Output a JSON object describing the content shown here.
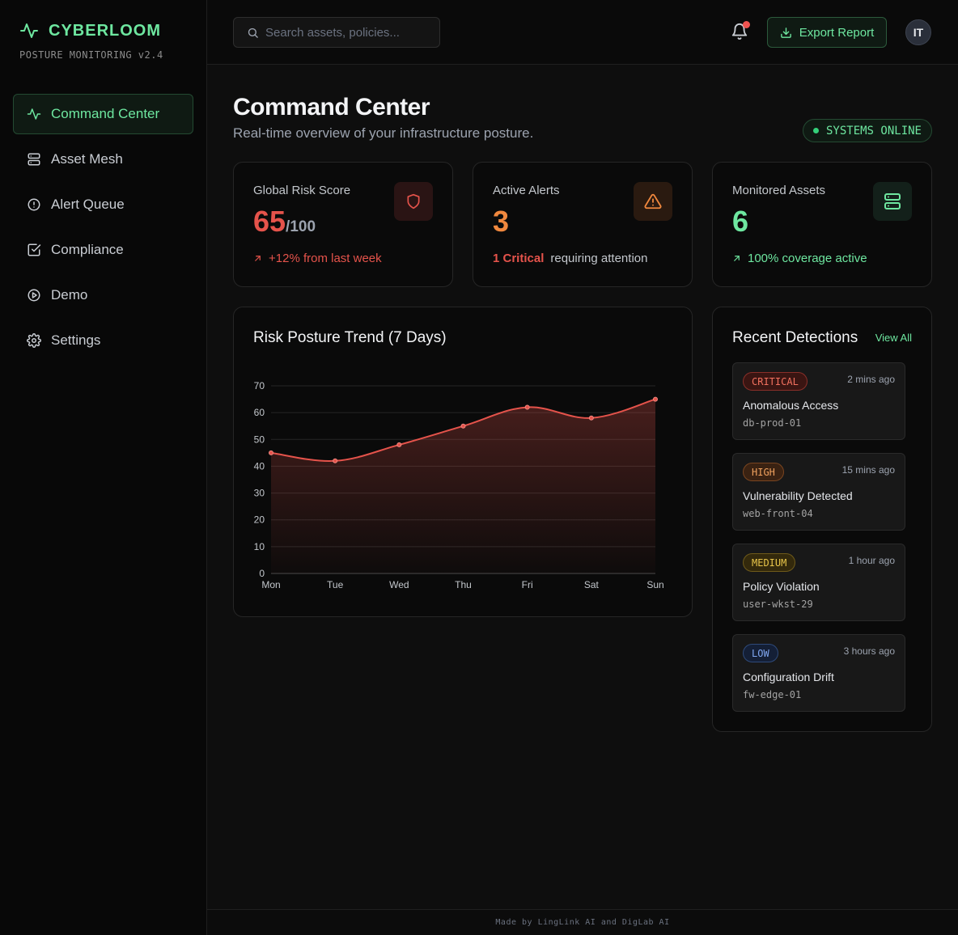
{
  "brand": {
    "name": "CYBERLOOM",
    "subtitle": "POSTURE MONITORING v2.4",
    "accent": "#6ee7a0"
  },
  "sidebar": {
    "items": [
      {
        "label": "Command Center",
        "icon": "activity-icon",
        "active": true
      },
      {
        "label": "Asset Mesh",
        "icon": "server-icon"
      },
      {
        "label": "Alert Queue",
        "icon": "alert-circle-icon"
      },
      {
        "label": "Compliance",
        "icon": "check-square-icon"
      },
      {
        "label": "Demo",
        "icon": "play-circle-icon"
      },
      {
        "label": "Settings",
        "icon": "gear-icon"
      }
    ]
  },
  "topbar": {
    "search_placeholder": "Search assets, policies...",
    "export_label": "Export Report",
    "avatar_initials": "IT"
  },
  "header": {
    "title": "Command Center",
    "subtitle": "Real-time overview of your infrastructure posture.",
    "status": "SYSTEMS ONLINE"
  },
  "stats": {
    "risk": {
      "label": "Global Risk Score",
      "value": "65",
      "suffix": "/100",
      "trend": "+12% from last week",
      "color": "#e5534b"
    },
    "alerts": {
      "label": "Active Alerts",
      "value": "3",
      "critical": "1 Critical",
      "note": "requiring attention",
      "color": "#f0883e"
    },
    "assets": {
      "label": "Monitored Assets",
      "value": "6",
      "trend": "100% coverage active",
      "color": "#6ee7a0"
    }
  },
  "chart_data": {
    "type": "area",
    "title": "Risk Posture Trend (7 Days)",
    "categories": [
      "Mon",
      "Tue",
      "Wed",
      "Thu",
      "Fri",
      "Sat",
      "Sun"
    ],
    "values": [
      45,
      42,
      48,
      55,
      62,
      58,
      65
    ],
    "ylim": [
      0,
      70
    ],
    "yticks": [
      0,
      10,
      20,
      30,
      40,
      50,
      60,
      70
    ],
    "grid": true,
    "color": "#e5534b"
  },
  "detections": {
    "title": "Recent Detections",
    "view_all": "View All",
    "items": [
      {
        "severity": "CRITICAL",
        "time": "2 mins ago",
        "title": "Anomalous Access",
        "host": "db-prod-01"
      },
      {
        "severity": "HIGH",
        "time": "15 mins ago",
        "title": "Vulnerability Detected",
        "host": "web-front-04"
      },
      {
        "severity": "MEDIUM",
        "time": "1 hour ago",
        "title": "Policy Violation",
        "host": "user-wkst-29"
      },
      {
        "severity": "LOW",
        "time": "3 hours ago",
        "title": "Configuration Drift",
        "host": "fw-edge-01"
      }
    ]
  },
  "footer": {
    "text": "Made by LingLink AI and DigLab AI"
  }
}
